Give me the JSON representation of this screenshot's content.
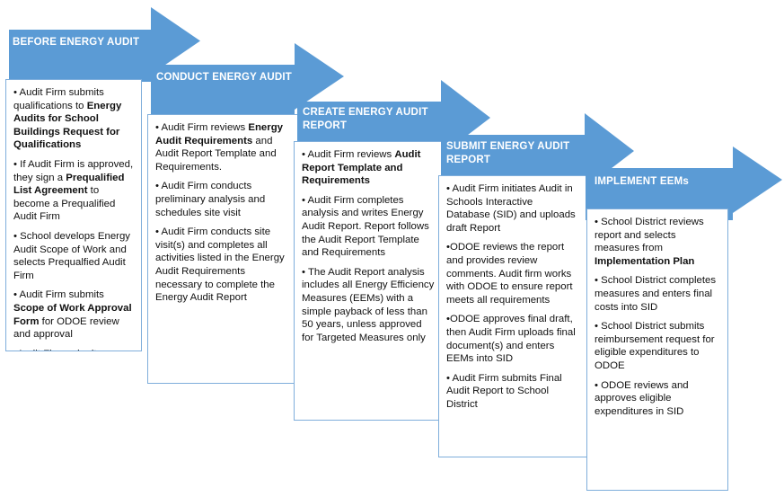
{
  "colors": {
    "arrow_fill": "#5B9BD5",
    "box_border": "#7FAEDB",
    "arrow_text": "#FFFFFF",
    "body_text": "#111111",
    "background": "#FFFFFF"
  },
  "stages": [
    {
      "id": "before-energy-audit",
      "title": "BEFORE ENERGY AUDIT",
      "bullets": [
        [
          {
            "t": "• Audit Firm submits qualifications to ",
            "b": false
          },
          {
            "t": "Energy Audits for School Buildings Request for Qualifications",
            "b": true
          }
        ],
        [
          {
            "t": "• If Audit Firm is approved, they sign a ",
            "b": false
          },
          {
            "t": "Prequalified List Agreement",
            "b": true
          },
          {
            "t": " to become a Prequalified Audit Firm",
            "b": false
          }
        ],
        [
          {
            "t": "• School develops Energy Audit Scope of Work and selects Prequalfied Audit Firm",
            "b": false
          }
        ],
        [
          {
            "t": "• Audit Firm submits ",
            "b": false
          },
          {
            "t": "Scope of Work Approval Form",
            "b": true
          },
          {
            "t": " for ODOE review and approval",
            "b": false
          }
        ],
        [
          {
            "t": "•Audit Firm submits signed Contract with school to ODOE, per approved Scope of Work Approval Form",
            "b": false
          }
        ]
      ]
    },
    {
      "id": "conduct-energy-audit",
      "title": "CONDUCT ENERGY AUDIT",
      "bullets": [
        [
          {
            "t": "• Audit Firm reviews ",
            "b": false
          },
          {
            "t": "Energy Audit Requirements",
            "b": true
          },
          {
            "t": " and Audit Report Template and Requirements.",
            "b": false
          }
        ],
        [
          {
            "t": "• Audit Firm conducts preliminary analysis and schedules site visit",
            "b": false
          }
        ],
        [
          {
            "t": "• Audit Firm conducts site visit(s) and completes all activities listed in the Energy Audit Requirements necessary to complete the Energy Audit Report",
            "b": false
          }
        ]
      ]
    },
    {
      "id": "create-energy-audit-report",
      "title": "CREATE ENERGY AUDIT REPORT",
      "bullets": [
        [
          {
            "t": "• Audit Firm reviews ",
            "b": false
          },
          {
            "t": "Audit Report Template and Requirements",
            "b": true
          }
        ],
        [
          {
            "t": "• Audit Firm completes analysis and writes Energy Audit Report. Report follows the Audit Report Template and Requirements",
            "b": false
          }
        ],
        [
          {
            "t": "• The Audit Report analysis includes all Energy Efficiency Measures (EEMs) with a simple payback of less than 50 years, unless approved for Targeted Measures only",
            "b": false
          }
        ]
      ]
    },
    {
      "id": "submit-energy-audit-report",
      "title": "SUBMIT ENERGY AUDIT REPORT",
      "bullets": [
        [
          {
            "t": "• Audit Firm initiates Audit in Schools Interactive Database (SID) and uploads draft Report",
            "b": false
          }
        ],
        [
          {
            "t": "•ODOE reviews the report and provides review comments. Audit firm works with ODOE to ensure report meets all requirements",
            "b": false
          }
        ],
        [
          {
            "t": "•ODOE approves final draft, then Audit Firm uploads final document(s) and enters EEMs into SID",
            "b": false
          }
        ],
        [
          {
            "t": "• Audit Firm submits Final Audit Report to School District",
            "b": false
          }
        ]
      ]
    },
    {
      "id": "implement-eems",
      "title": "IMPLEMENT EEMs",
      "bullets": [
        [
          {
            "t": "• School District reviews report and selects measures from ",
            "b": false
          },
          {
            "t": "Implementation Plan",
            "b": true
          }
        ],
        [
          {
            "t": "• School District completes measures and enters final costs into SID",
            "b": false
          }
        ],
        [
          {
            "t": "• School District submits reimbursement request for eligible expenditures to ODOE",
            "b": false
          }
        ],
        [
          {
            "t": "• ODOE reviews and approves eligible expenditures in SID",
            "b": false
          }
        ]
      ]
    }
  ]
}
